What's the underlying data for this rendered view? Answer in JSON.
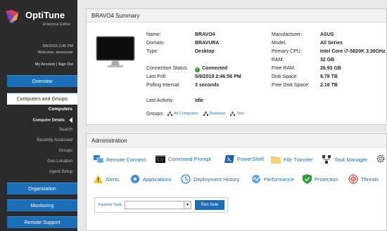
{
  "app": {
    "name": "OptiTune",
    "edition": "Enterprise Edition"
  },
  "user": {
    "datetime": "5/9/2019 2:46 PM",
    "welcome": "Welcome, demouser",
    "my_account": "My Account",
    "separator": "|",
    "sign_out": "Sign Out"
  },
  "nav": {
    "overview": "Overview",
    "computers_groups": "Computers and Groups",
    "sub": [
      "Computers",
      "Computer Details",
      "Search",
      "Recently Accessed",
      "Groups",
      "Geo Location",
      "Agent Setup"
    ],
    "organization": "Organization",
    "monitoring": "Monitoring",
    "remote_support": "Remote Support"
  },
  "summary": {
    "title": "BRAVO4 Summary",
    "left": [
      {
        "label": "Name:",
        "value": "BRAVO4"
      },
      {
        "label": "Domain:",
        "value": "BRAVURA"
      },
      {
        "label": "Type:",
        "value": "Desktop"
      },
      {
        "label": "Connection Status:",
        "value": "Connected"
      },
      {
        "label": "Last Poll:",
        "value": "5/9/2019 2:46:56 PM"
      },
      {
        "label": "Polling Interval:",
        "value": "3 seconds"
      },
      {
        "label": "Last Activity:",
        "value": "Idle"
      }
    ],
    "right": [
      {
        "label": "Manufacturer:",
        "value": "ASUS"
      },
      {
        "label": "Model:",
        "value": "All Series"
      },
      {
        "label": "Primary CPU:",
        "value": "Intel Core i7-5820K 3.30GHz"
      },
      {
        "label": "RAM:",
        "value": "32 GB"
      },
      {
        "label": "Free RAM:",
        "value": "26.93 GB"
      },
      {
        "label": "Disk Space:",
        "value": "9.78 TB"
      },
      {
        "label": "Free Disk Space:",
        "value": "2.16 TB"
      }
    ],
    "groups_label": "Groups:",
    "groups": [
      "All Computers",
      "Desktops",
      "Test"
    ]
  },
  "admin": {
    "title": "Administration",
    "tools_row1": [
      "Remote Connect",
      "Command Prompt",
      "PowerShell",
      "File Transfer",
      "Task Manager"
    ],
    "tools_row2": [
      "Alerts",
      "Applications",
      "Deployment History",
      "Performance",
      "Protection",
      "Threats"
    ],
    "favorite_label": "Favorite Task:",
    "favorite_value": "",
    "run_button": "Run Now"
  },
  "colors": {
    "accent": "#1b6fb8",
    "sidebar": "#2b2b2b",
    "ok": "#2e9e3a"
  }
}
